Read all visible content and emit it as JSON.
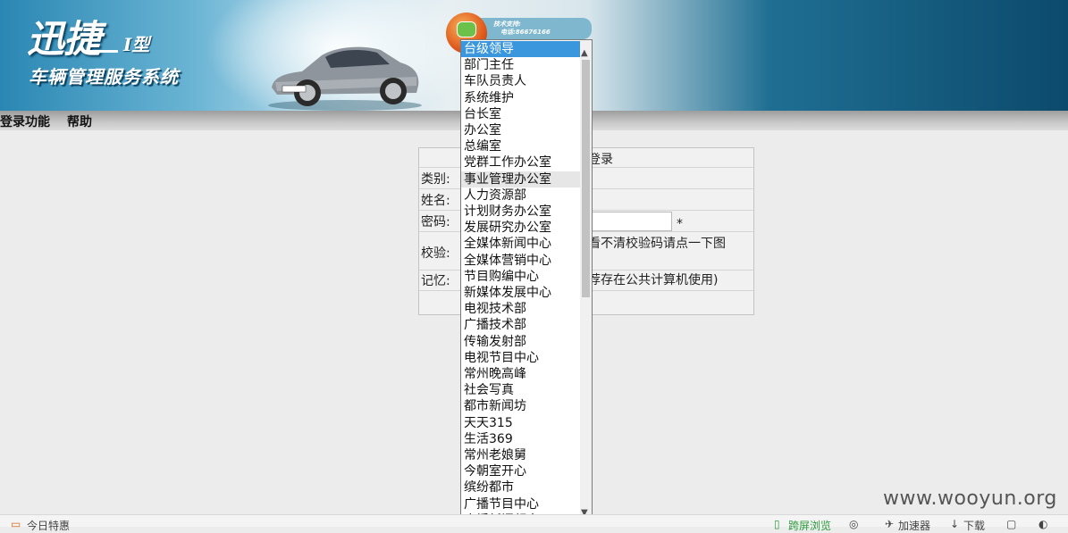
{
  "header": {
    "logo_main": "迅捷",
    "logo_type": "I型",
    "logo_sub": "车辆管理服务系统",
    "support_label": "技术支持:",
    "support_phone": "电话:86676166"
  },
  "menu": {
    "login_func": "登录功能",
    "help": "帮助"
  },
  "login_form": {
    "title_fragment": "登录",
    "category_label": "类别:",
    "name_label": "姓名:",
    "password_label": "密码:",
    "required_mark": "*",
    "captcha_label": "校验:",
    "captcha_hint_fragment": "看不清校验码请点一下图",
    "remember_label": "记忆:",
    "remember_hint_fragment": "荐存在公共计算机使用)"
  },
  "dropdown": {
    "selected": "台级领导",
    "hovered": "事业管理办公室",
    "options": [
      "台级领导",
      "部门主任",
      "车队员责人",
      "系统维护",
      "台长室",
      "办公室",
      "总编室",
      "党群工作办公室",
      "事业管理办公室",
      "人力资源部",
      "计划财务办公室",
      "发展研究办公室",
      "全媒体新闻中心",
      "全媒体营销中心",
      "节目购编中心",
      "新媒体发展中心",
      "电视技术部",
      "广播技术部",
      "传输发射部",
      "电视节目中心",
      "常州晚高峰",
      "社会写真",
      "都市新闻坊",
      "天天315",
      "生活369",
      "常州老娘舅",
      "今朝室开心",
      "缤纷都市",
      "广播节目中心",
      "广播新闻频率"
    ]
  },
  "watermark": "www.wooyun.org",
  "statusbar": {
    "left": "今日特惠",
    "browse": "跨屏浏览",
    "accelerator": "加速器",
    "download": "下载"
  },
  "colors": {
    "selected_bg": "#3a96dd",
    "banner_dark": "#0c4a6c"
  }
}
